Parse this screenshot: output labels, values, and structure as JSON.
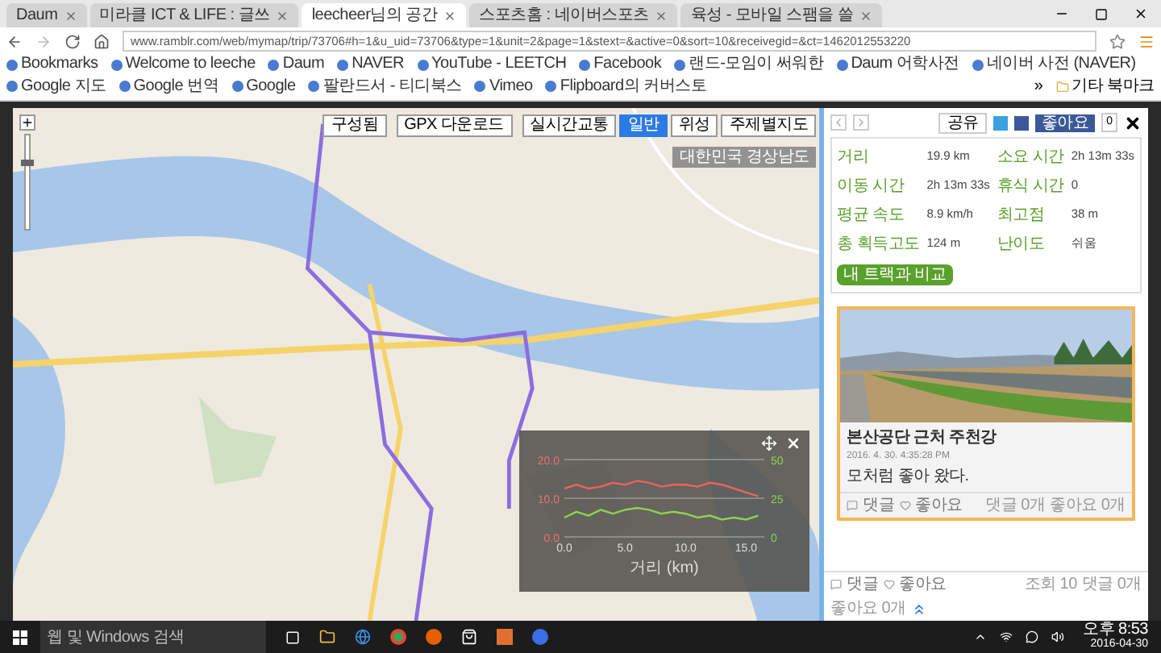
{
  "browser": {
    "tabs": [
      {
        "label": "Daum",
        "selected": false
      },
      {
        "label": "미라클 ICT & LIFE : 글쓰",
        "selected": false
      },
      {
        "label": "leecheer님의 공간",
        "selected": true
      },
      {
        "label": "스포츠홈 : 네이버스포츠",
        "selected": false
      },
      {
        "label": "육성 - 모바일 스팸을 쓸",
        "selected": false
      }
    ],
    "url": "www.ramblr.com/web/mymap/trip/73706#h=1&u_uid=73706&type=1&unit=2&page=1&stext=&active=0&sort=10&receivegid=&ct=1462012553220",
    "bookmarks": [
      "Bookmarks",
      "Welcome to leeche",
      "Daum",
      "NAVER",
      "YouTube - LEETCH",
      "Facebook",
      "랜드-모임이 써워한",
      "Daum 어학사전",
      "네이버 사전 (NAVER)",
      "Google 지도",
      "Google 번역",
      "Google",
      "팔란드서 - 티디북스",
      "Vimeo",
      "Flipboard의 커버스토"
    ],
    "more": "»",
    "other_bookmarks": "기타 북마크"
  },
  "map": {
    "zoom": {
      "level": 0.7
    },
    "buttons": [
      "구성됨",
      "GPX 다운로드"
    ],
    "map_types": [
      {
        "label": "실시간교통",
        "selected": false
      },
      {
        "label": "일반",
        "selected": true
      },
      {
        "label": "위성",
        "selected": false
      },
      {
        "label": "주제별지도",
        "selected": false
      }
    ],
    "region": "대한민국 경상남도",
    "chart": {
      "right_ticks": [
        "50",
        "25",
        "0"
      ],
      "chart_data": {
        "type": "line",
        "xlabel": "거리 (km)",
        "x": [
          0,
          1,
          2,
          3,
          4,
          5,
          6,
          7,
          8,
          9,
          10,
          11,
          12,
          13,
          14,
          15,
          16
        ],
        "xlim": [
          0,
          16.5
        ],
        "ylim": [
          0,
          20
        ],
        "xticks": [
          {
            "value": 0,
            "label": "0.0"
          },
          {
            "value": 5,
            "label": "5.0"
          },
          {
            "value": 10,
            "label": "10.0"
          },
          {
            "value": 15,
            "label": "15.0"
          }
        ],
        "yticks": [
          {
            "value": 0,
            "label": "0.0"
          },
          {
            "value": 10,
            "label": "10.0"
          },
          {
            "value": 20,
            "label": "20.0"
          }
        ],
        "series": [
          {
            "color": "#f06060",
            "values": [
              12.5,
              13.5,
              12.5,
              13,
              14,
              13.5,
              14.5,
              14,
              13,
              13.5,
              13.5,
              13,
              14,
              13.5,
              12.5,
              11.5,
              10.5
            ]
          },
          {
            "color": "#8fd14f",
            "values": [
              5,
              6.5,
              5.5,
              7,
              6,
              7,
              7.5,
              7,
              6,
              6.5,
              6,
              5,
              5.5,
              4.5,
              5,
              4.5,
              5.5
            ]
          }
        ]
      }
    }
  },
  "panel": {
    "share": "공유",
    "like": "좋아요",
    "like_count": "0",
    "stats": [
      {
        "label": "거리",
        "value": "19.9 km"
      },
      {
        "label": "소요 시간",
        "value": "2h 13m 33s"
      },
      {
        "label": "이동 시간",
        "value": "2h 13m 33s"
      },
      {
        "label": "휴식 시간",
        "value": "0"
      },
      {
        "label": "평균 속도",
        "value": "8.9 km/h"
      },
      {
        "label": "최고점",
        "value": "38 m"
      },
      {
        "label": "총 획득고도",
        "value": "124 m"
      },
      {
        "label": "난이도",
        "value": "쉬움"
      }
    ],
    "compare": "내 트랙과 비교",
    "post": {
      "title": "본산공단 근처 주천강",
      "date": "2016. 4. 30. 4:35:28 PM",
      "text": "모처럼 좋아 왔다.",
      "comment": "댓글",
      "like": "좋아요",
      "comment_count": "댓글 0개",
      "like_count": "좋아요 0개"
    },
    "footer": {
      "comment": "댓글",
      "like": "좋아요",
      "views": "조회 10",
      "comment_count": "댓글 0개",
      "like_count": "좋아요 0개"
    }
  },
  "taskbar": {
    "search": "웹 및 Windows 검색",
    "time": "오후 8:53",
    "date": "2016-04-30"
  }
}
